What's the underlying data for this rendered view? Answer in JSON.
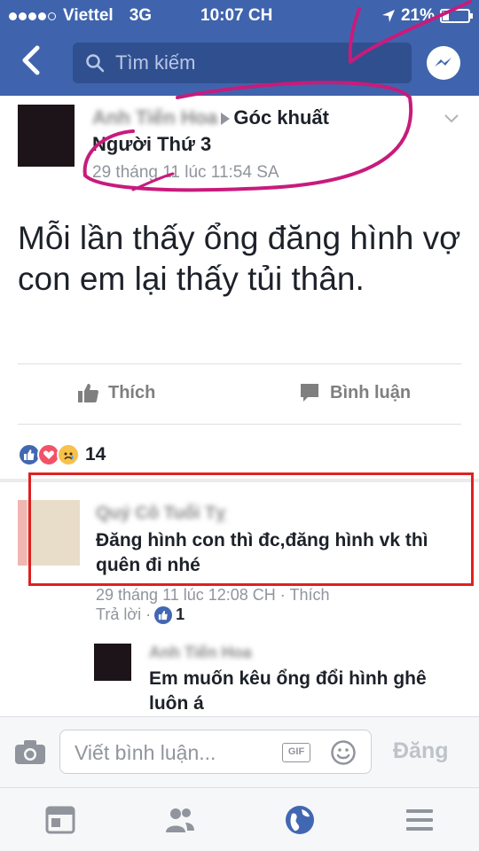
{
  "status_bar": {
    "carrier": "Viettel",
    "network": "3G",
    "time": "10:07 CH",
    "battery": "21%"
  },
  "nav": {
    "search_placeholder": "Tìm kiếm"
  },
  "post": {
    "author": "Anh Tiến Hoa",
    "group_line1": "Góc khuất",
    "group_line2": "Người Thứ 3",
    "timestamp": "29 tháng 11 lúc 11:54 SA",
    "text": "Mỗi lần thấy ổng đăng hình vợ con em lại thấy tủi thân.",
    "actions": {
      "like": "Thích",
      "comment": "Bình luận"
    },
    "reaction_count": "14"
  },
  "comments": [
    {
      "author": "Quý Cô Tuổi Tỵ",
      "text": "Đăng hình con thì đc,đăng hình vk thì quên đi nhé",
      "meta": "29 tháng 11 lúc 12:08 CH · Thích",
      "reply_label": "Trả lời ·",
      "like_count": "1"
    }
  ],
  "reply": {
    "author": "Anh Tiến Hoa",
    "text": "Em muốn kêu ổng đổi hình ghê luôn á"
  },
  "composer": {
    "placeholder": "Viết bình luận...",
    "gif_label": "GIF",
    "post_label": "Đăng"
  },
  "colors": {
    "brand": "#3f64ad",
    "annotation_magenta": "#c81b7c",
    "annotation_red": "#e02020"
  }
}
